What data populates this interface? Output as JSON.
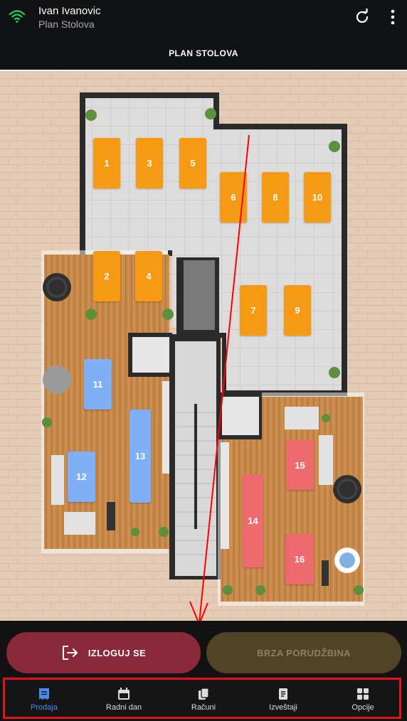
{
  "header": {
    "user_name": "Ivan Ivanovic",
    "subtitle": "Plan Stolova",
    "title": "PLAN STOLOVA",
    "icons": [
      "wifi-icon",
      "refresh-icon",
      "more-vert-icon"
    ]
  },
  "tables": [
    {
      "label": "1",
      "zone": "terrace",
      "color": "orange"
    },
    {
      "label": "3",
      "zone": "terrace",
      "color": "orange"
    },
    {
      "label": "5",
      "zone": "terrace",
      "color": "orange"
    },
    {
      "label": "6",
      "zone": "terrace",
      "color": "orange"
    },
    {
      "label": "8",
      "zone": "terrace",
      "color": "orange"
    },
    {
      "label": "10",
      "zone": "terrace",
      "color": "orange"
    },
    {
      "label": "2",
      "zone": "terrace",
      "color": "orange"
    },
    {
      "label": "4",
      "zone": "terrace",
      "color": "orange"
    },
    {
      "label": "7",
      "zone": "terrace",
      "color": "orange"
    },
    {
      "label": "9",
      "zone": "terrace",
      "color": "orange"
    },
    {
      "label": "11",
      "zone": "left-deck",
      "color": "blue"
    },
    {
      "label": "13",
      "zone": "left-deck",
      "color": "blue"
    },
    {
      "label": "12",
      "zone": "left-deck",
      "color": "blue"
    },
    {
      "label": "15",
      "zone": "right-deck",
      "color": "red"
    },
    {
      "label": "14",
      "zone": "right-deck",
      "color": "red"
    },
    {
      "label": "16",
      "zone": "right-deck",
      "color": "red"
    }
  ],
  "colors": {
    "orange": "#f59a12",
    "blue": "#7fb0f7",
    "red": "#ef6a6e",
    "logout_bg": "#8a2939",
    "quick_bg": "#514426",
    "active_nav": "#4a8df0",
    "highlight": "#e0131b"
  },
  "actions": {
    "logout_label": "IZLOGUJ SE",
    "quick_order_label": "BRZA PORUDŽBINA"
  },
  "nav": {
    "items": [
      {
        "label": "Prodaja",
        "icon": "sales-icon",
        "active": true
      },
      {
        "label": "Radni dan",
        "icon": "calendar-icon",
        "active": false
      },
      {
        "label": "Računi",
        "icon": "receipts-icon",
        "active": false
      },
      {
        "label": "Izveštaji",
        "icon": "report-icon",
        "active": false
      },
      {
        "label": "Opcije",
        "icon": "grid-options-icon",
        "active": false
      }
    ]
  }
}
